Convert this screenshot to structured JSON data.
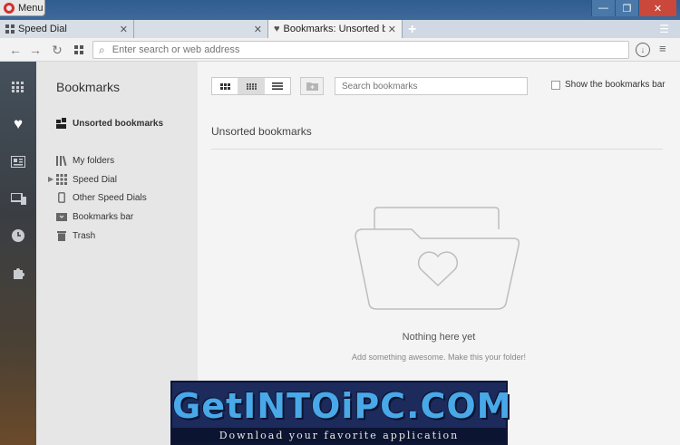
{
  "window": {
    "menu_label": "Menu",
    "controls": {
      "minimize": "—",
      "maximize": "❐",
      "close": "✕"
    }
  },
  "tabs": [
    {
      "title": "Speed Dial",
      "icon": "speed-dial-icon",
      "active": false,
      "close": "✕"
    },
    {
      "title": "",
      "icon": "",
      "active": false,
      "close": "✕"
    },
    {
      "title": "Bookmarks: Unsorted book",
      "icon": "heart-icon",
      "active": true,
      "close": "✕"
    }
  ],
  "new_tab": "+",
  "address_bar": {
    "placeholder": "Enter search or web address",
    "value": ""
  },
  "sidebar": {
    "items": [
      {
        "icon": "speed-dial-icon",
        "active": false
      },
      {
        "icon": "heart-icon",
        "active": true
      },
      {
        "icon": "news-icon",
        "active": false
      },
      {
        "icon": "devices-icon",
        "active": false
      },
      {
        "icon": "history-icon",
        "active": false
      },
      {
        "icon": "extensions-icon",
        "active": false
      }
    ]
  },
  "bookmarks_nav": {
    "title": "Bookmarks",
    "items": [
      {
        "label": "Unsorted bookmarks",
        "icon": "unsorted-icon",
        "bold": true
      },
      {
        "label": "My folders",
        "icon": "folders-icon",
        "bold": false
      },
      {
        "label": "Speed Dial",
        "icon": "speed-dial-icon",
        "bold": false,
        "expandable": true
      },
      {
        "label": "Other Speed Dials",
        "icon": "phone-icon",
        "bold": false
      },
      {
        "label": "Bookmarks bar",
        "icon": "bookmarks-bar-icon",
        "bold": false
      },
      {
        "label": "Trash",
        "icon": "trash-icon",
        "bold": false
      }
    ]
  },
  "main": {
    "search_placeholder": "Search bookmarks",
    "show_bar_label": "Show the bookmarks bar",
    "show_bar_checked": false,
    "heading": "Unsorted bookmarks",
    "empty_title": "Nothing here yet",
    "empty_subtitle": "Add something awesome. Make this your folder!"
  },
  "watermark": {
    "logo": "GetINTOiPC.COM",
    "tagline": "Download your favorite application"
  },
  "colors": {
    "accent_red": "#d32f2f",
    "titlebar": "#2f5d8f",
    "sidebar_dark": "#3a3e43",
    "pane_bg": "#e6e6e6",
    "main_bg": "#f4f4f4"
  }
}
